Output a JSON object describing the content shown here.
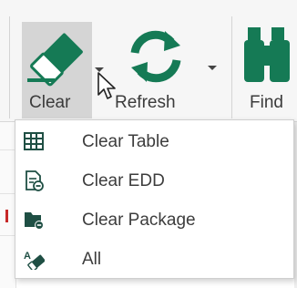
{
  "ribbon": {
    "clear": {
      "label": "Clear",
      "icon": "eraser-icon"
    },
    "refresh": {
      "label": "Refresh",
      "icon": "refresh-icon"
    },
    "find": {
      "label": "Find",
      "icon": "binoculars-icon"
    }
  },
  "clear_menu": {
    "items": [
      {
        "label": "Clear Table",
        "icon": "table-grid-icon"
      },
      {
        "label": "Clear EDD",
        "icon": "edd-document-icon"
      },
      {
        "label": "Clear Package",
        "icon": "package-folder-icon"
      },
      {
        "label": "All",
        "icon": "clear-all-icon"
      }
    ]
  },
  "colors": {
    "accent_green": "#157a55",
    "pressed_bg": "#d5d5d5",
    "ribbon_bg": "#f6f6f6",
    "menu_icon_dark": "#1f4f44",
    "grid_mark_red": "#c62828"
  }
}
